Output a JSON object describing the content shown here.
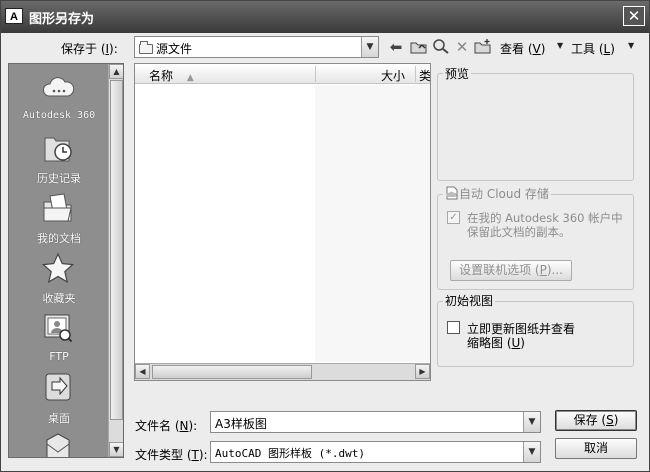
{
  "title": "图形另存为",
  "app_icon_text": "A",
  "save_in": {
    "label_pre": "保存于 (",
    "mnemonic": "I",
    "label_post": "):",
    "value": "源文件"
  },
  "toolbar": {
    "views_pre": "查看 (",
    "views_mn": "V",
    "views_post": ")",
    "tools_pre": "工具 (",
    "tools_mn": "L",
    "tools_post": ")"
  },
  "places": [
    {
      "label": "Autodesk 360",
      "icon": "cloud-icon"
    },
    {
      "label": "历史记录",
      "icon": "history-icon"
    },
    {
      "label": "我的文档",
      "icon": "documents-icon"
    },
    {
      "label": "收藏夹",
      "icon": "favorites-icon"
    },
    {
      "label": "FTP",
      "icon": "ftp-icon"
    },
    {
      "label": "桌面",
      "icon": "desktop-icon"
    }
  ],
  "file_list": {
    "col_name": "名称",
    "col_size": "大小",
    "col_type": "类"
  },
  "preview": {
    "title": "预览"
  },
  "cloud": {
    "title": "自动 Cloud 存储",
    "check_line1": "在我的 Autodesk 360 帐户中",
    "check_line2": "保留此文档的副本。",
    "button_pre": "设置联机选项 (",
    "button_mn": "P",
    "button_post": ")..."
  },
  "initial_view": {
    "title": "初始视图",
    "check_line1": "立即更新图纸并查看",
    "check_line2_pre": "缩略图 (",
    "check_line2_mn": "U",
    "check_line2_post": ")"
  },
  "filename": {
    "label_pre": "文件名 (",
    "mnemonic": "N",
    "label_post": "):",
    "value": "A3样板图"
  },
  "filetype": {
    "label_pre": "文件类型 (",
    "mnemonic": "T",
    "label_post": "):",
    "value": "AutoCAD 图形样板 (*.dwt)"
  },
  "buttons": {
    "save_pre": "保存 (",
    "save_mn": "S",
    "save_post": ")",
    "cancel": "取消"
  },
  "colors": {
    "title_bar": "#4a4a4a",
    "places_bg": "#8e8e8e",
    "dialog_bg": "#ececec"
  }
}
